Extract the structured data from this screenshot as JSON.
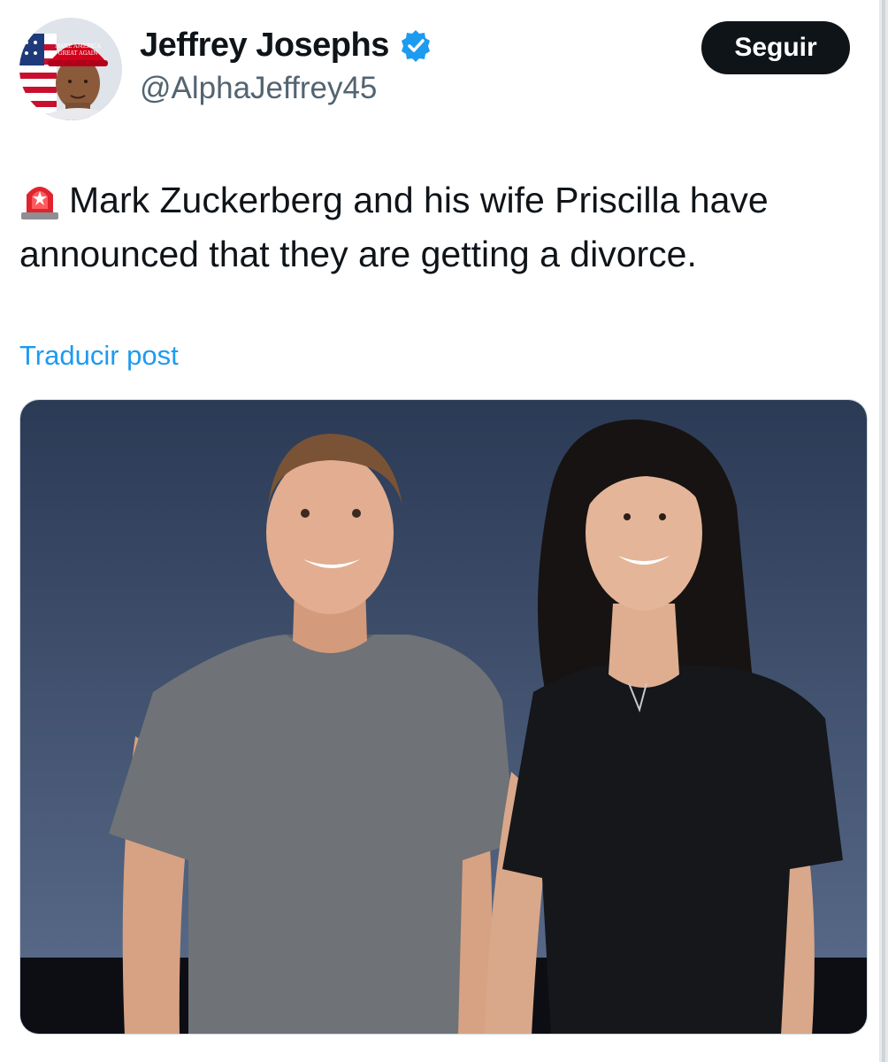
{
  "author": {
    "display_name": "Jeffrey Josephs",
    "handle": "@AlphaJeffrey45",
    "verified": true,
    "avatar_icon": "avatar-red-maga-hat",
    "hat_text": "MAKE AMERICA GREAT AGAIN"
  },
  "follow_button": {
    "label": "Seguir"
  },
  "post": {
    "emoji_icon": "police-siren-icon",
    "text": "Mark Zuckerberg and his wife Priscilla have announced that they are getting a divorce."
  },
  "translate_link": {
    "label": "Traducir post"
  },
  "media": {
    "description_icon": "photo-two-people-on-stage"
  },
  "colors": {
    "accent": "#1d9bf0",
    "button_bg": "#0f1419",
    "muted": "#536471"
  }
}
